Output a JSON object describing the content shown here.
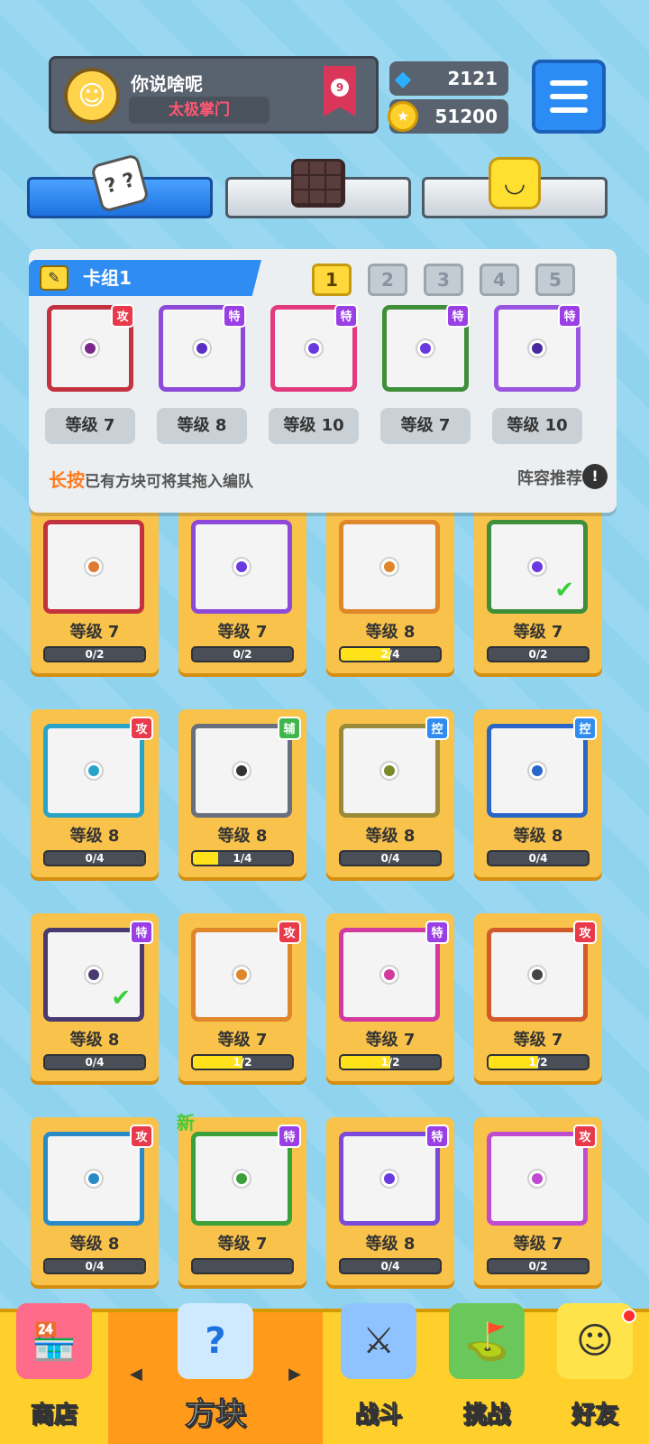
{
  "profile": {
    "name": "你说啥呢",
    "title": "太极掌门",
    "rank": "9"
  },
  "currency": {
    "gems": "2121",
    "coins": "51200"
  },
  "tabs": [
    "dice",
    "chocolate",
    "smile"
  ],
  "deck": {
    "title": "卡组1",
    "slots": [
      "1",
      "2",
      "3",
      "4",
      "5"
    ],
    "active_slot": 1,
    "cards": [
      {
        "tag": "攻",
        "level": "等级 7",
        "color": "#c3323f",
        "dot": "#7a2b8a"
      },
      {
        "tag": "特",
        "level": "等级 8",
        "color": "#8d4ad8",
        "dot": "#5a2fc2"
      },
      {
        "tag": "特",
        "level": "等级 10",
        "color": "#e23a7d",
        "dot": "#6a3ae0"
      },
      {
        "tag": "特",
        "level": "等级 7",
        "color": "#3f8f3a",
        "dot": "#6a3ae0"
      },
      {
        "tag": "特",
        "level": "等级 10",
        "color": "#9a55e0",
        "dot": "#4a2aa0"
      }
    ],
    "hint_highlight": "长按",
    "hint_rest": "已有方块可将其拖入编队",
    "recommend": "阵容推荐"
  },
  "grid": [
    {
      "tag": "",
      "level": "等级 7",
      "progress": "0/2",
      "fill": 0,
      "color": "#c3323f",
      "dot": "#e07a30",
      "check": false,
      "new": false
    },
    {
      "tag": "",
      "level": "等级 7",
      "progress": "0/2",
      "fill": 0,
      "color": "#8d4ad8",
      "dot": "#6a3ae0",
      "check": false,
      "new": false
    },
    {
      "tag": "",
      "level": "等级 8",
      "progress": "2/4",
      "fill": 0.5,
      "color": "#e0862b",
      "dot": "#e0862b",
      "check": false,
      "new": false
    },
    {
      "tag": "",
      "level": "等级 7",
      "progress": "0/2",
      "fill": 0,
      "color": "#3f8f3a",
      "dot": "#6a3ae0",
      "check": true,
      "new": false
    },
    {
      "tag": "攻",
      "level": "等级 8",
      "progress": "0/4",
      "fill": 0,
      "color": "#2aa3c8",
      "dot": "#2aa3c8",
      "check": false,
      "new": false
    },
    {
      "tag": "辅",
      "level": "等级 8",
      "progress": "1/4",
      "fill": 0.25,
      "color": "#6a6f7e",
      "dot": "#333333",
      "check": false,
      "new": false
    },
    {
      "tag": "控",
      "level": "等级 8",
      "progress": "0/4",
      "fill": 0,
      "color": "#9a8a3a",
      "dot": "#7a8a2a",
      "check": false,
      "new": false
    },
    {
      "tag": "控",
      "level": "等级 8",
      "progress": "0/4",
      "fill": 0,
      "color": "#2a66c8",
      "dot": "#2a66c8",
      "check": false,
      "new": false
    },
    {
      "tag": "特",
      "level": "等级 8",
      "progress": "0/4",
      "fill": 0,
      "color": "#4a3a70",
      "dot": "#4a3a70",
      "check": true,
      "new": false
    },
    {
      "tag": "攻",
      "level": "等级 7",
      "progress": "1/2",
      "fill": 0.5,
      "color": "#e0862b",
      "dot": "#e0862b",
      "check": false,
      "new": false
    },
    {
      "tag": "特",
      "level": "等级 7",
      "progress": "1/2",
      "fill": 0.5,
      "color": "#d23aa0",
      "dot": "#d23aa0",
      "check": false,
      "new": false
    },
    {
      "tag": "攻",
      "level": "等级 7",
      "progress": "1/2",
      "fill": 0.5,
      "color": "#d25a2a",
      "dot": "#444444",
      "check": false,
      "new": false
    },
    {
      "tag": "攻",
      "level": "等级 8",
      "progress": "0/4",
      "fill": 0,
      "color": "#2a8ac8",
      "dot": "#2a8ac8",
      "check": false,
      "new": false
    },
    {
      "tag": "特",
      "level": "等级 7",
      "progress": "",
      "fill": 0,
      "color": "#3aa03a",
      "dot": "#3aa03a",
      "check": false,
      "new": true
    },
    {
      "tag": "特",
      "level": "等级 8",
      "progress": "0/4",
      "fill": 0,
      "color": "#7a4ad8",
      "dot": "#6a3ae0",
      "check": false,
      "new": false
    },
    {
      "tag": "攻",
      "level": "等级 7",
      "progress": "0/2",
      "fill": 0,
      "color": "#c04ad0",
      "dot": "#c04ad0",
      "check": false,
      "new": false
    }
  ],
  "new_label": "新",
  "nav": {
    "shop": "商店",
    "blocks": "方块",
    "battle": "战斗",
    "challenge": "挑战",
    "friends": "好友"
  },
  "colors": {
    "accent": "#2f8df2",
    "nav_bg": "#ffcf2b",
    "active_nav": "#ff9a1a"
  }
}
